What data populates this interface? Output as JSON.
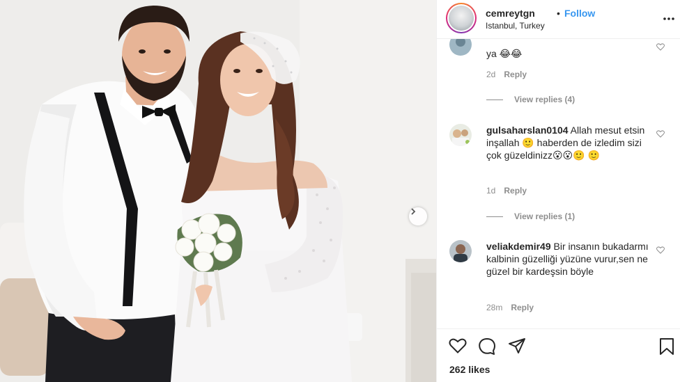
{
  "post": {
    "username": "cemreytgn",
    "separator": "•",
    "follow_label": "Follow",
    "location": "Istanbul, Turkey",
    "more_label": "•••",
    "likes": "262 likes"
  },
  "comments": [
    {
      "username": "",
      "text": "ya 😂😂",
      "time": "2d",
      "reply_label": "Reply",
      "view_replies": "View replies (4)"
    },
    {
      "username": "gulsaharslan0104",
      "text": " Allah mesut etsin inşallah 🙂 haberden de izledim sizi çok güzeldinizz😮😮🙂 🙂",
      "time": "1d",
      "reply_label": "Reply",
      "view_replies": "View replies (1)"
    },
    {
      "username": "veliakdemir49",
      "text": " Bir insanın bukadarmı kalbinin güzelliği yüzüne vurur,sen ne güzel bir kardeşsin böyle",
      "time": "28m",
      "reply_label": "Reply"
    }
  ],
  "icons": [
    "heart-icon",
    "comment-icon",
    "share-icon",
    "bookmark-icon",
    "chevron-right-icon",
    "more-icon"
  ],
  "colors": {
    "link": "#3897f0",
    "meta": "#8e8e8e",
    "text": "#262626",
    "divider": "#efefef"
  }
}
